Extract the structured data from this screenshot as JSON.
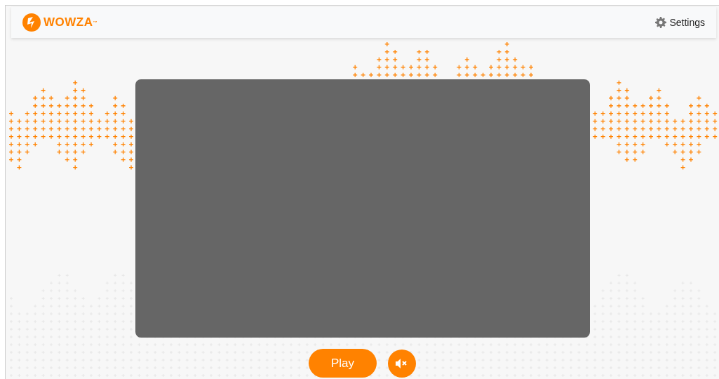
{
  "logo": {
    "text": "WOWZA$^{™}$"
  },
  "nav": {
    "settings": "Settings"
  },
  "player": {
    "play_label": "Play",
    "muted": true
  }
}
